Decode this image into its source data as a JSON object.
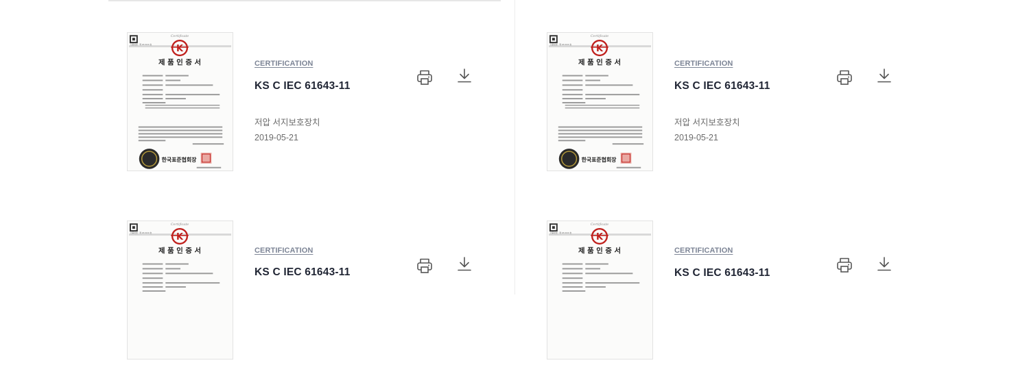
{
  "cards": [
    {
      "category": "CERTIFICATION",
      "title": "KS C IEC 61643-11",
      "description": "저압 서지보호장치",
      "date": "2019-05-21"
    },
    {
      "category": "CERTIFICATION",
      "title": "KS C IEC 61643-11",
      "description": "저압 서지보호장치",
      "date": "2019-05-21"
    },
    {
      "category": "CERTIFICATION",
      "title": "KS C IEC 61643-11"
    },
    {
      "category": "CERTIFICATION",
      "title": "KS C IEC 61643-11"
    }
  ],
  "certificate": {
    "script_header": "Certificate",
    "mark": "K",
    "heading": "제 품 인 증 서",
    "issuer": "한국표준협회장"
  },
  "icons": {
    "print": "printer-icon",
    "download": "download-icon"
  }
}
